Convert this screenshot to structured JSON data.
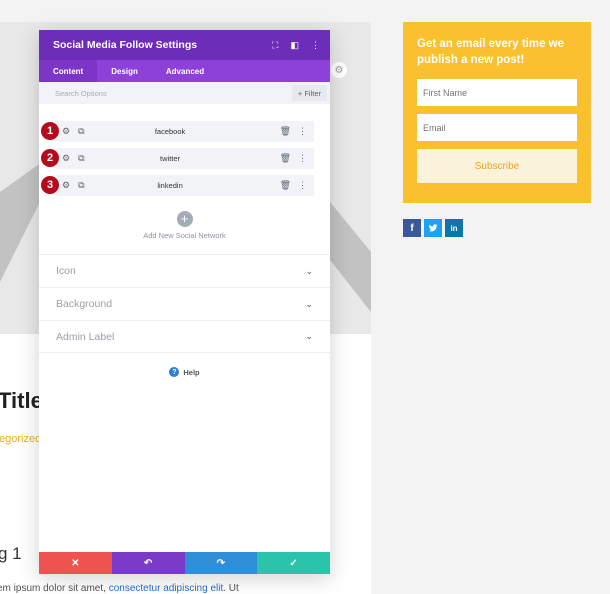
{
  "background_page": {
    "post_title": "Title",
    "category": "egorized",
    "heading": "g 1",
    "paragraph_text": "em ipsum dolor sit amet,",
    "paragraph_link": "consectetur adipiscing elit",
    "paragraph_tail": ". Ut",
    "optin": {
      "title": "Get an email every time we publish a new post!",
      "first_name_placeholder": "First Name",
      "email_placeholder": "Email",
      "subscribe_label": "Subscribe"
    },
    "social_icons": [
      "facebook-icon",
      "twitter-icon",
      "linkedin-icon"
    ]
  },
  "modal": {
    "title": "Social Media Follow Settings",
    "tabs": [
      {
        "label": "Content",
        "active": true
      },
      {
        "label": "Design",
        "active": false
      },
      {
        "label": "Advanced",
        "active": false
      }
    ],
    "search_placeholder": "Search Options",
    "filter_label": "+ Filter",
    "networks": [
      {
        "badge": "1",
        "label": "facebook"
      },
      {
        "badge": "2",
        "label": "twitter"
      },
      {
        "badge": "3",
        "label": "linkedin"
      }
    ],
    "add_label": "Add New Social Network",
    "sections": [
      {
        "label": "Icon"
      },
      {
        "label": "Background"
      },
      {
        "label": "Admin Label"
      }
    ],
    "help_label": "Help"
  },
  "colors": {
    "header": "#6c2eb9",
    "tabs": "#8e41d8",
    "badge": "#b40c1d",
    "optin": "#fbc02d",
    "close": "#ef5350",
    "undo": "#7b3ac7",
    "redo": "#2f8ed8",
    "save": "#29c4a9"
  }
}
